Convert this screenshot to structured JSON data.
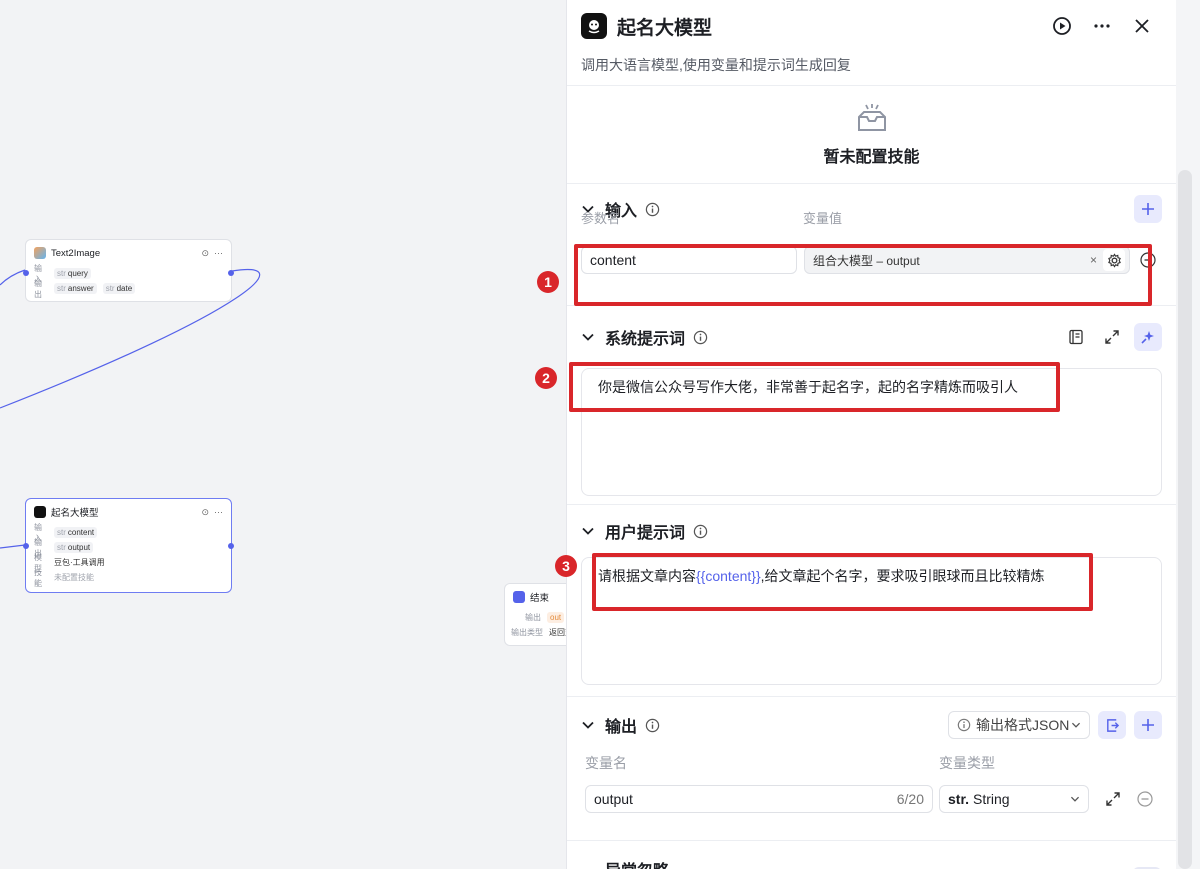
{
  "canvas": {
    "text2image": {
      "title": "Text2Image",
      "in_label": "输入",
      "out_label": "输出",
      "in_vars": [
        "query"
      ],
      "out_vars": [
        "answer",
        "date"
      ],
      "type_prefix": "str"
    },
    "naming_node": {
      "title": "起名大模型",
      "rows": [
        {
          "k": "输入",
          "v": "content"
        },
        {
          "k": "输出",
          "v": "output"
        },
        {
          "k": "模型",
          "v": "豆包·工具调用"
        },
        {
          "k": "技能",
          "v": "未配置技能"
        }
      ],
      "type_prefix": "str"
    },
    "end_node": {
      "title": "结束",
      "row1_k": "输出",
      "row1_v": "out",
      "row2_k": "输出类型",
      "row2_v": "返回变"
    }
  },
  "panel": {
    "title": "起名大模型",
    "description": "调用大语言模型,使用变量和提示词生成回复",
    "skill_empty": "暂未配置技能",
    "input": {
      "title": "输入",
      "col_param": "参数名",
      "col_value": "变量值",
      "param_value": "content",
      "var_value": "组合大模型 – output"
    },
    "system_prompt": {
      "title": "系统提示词",
      "text": "你是微信公众号写作大佬，非常善于起名字，起的名字精炼而吸引人"
    },
    "user_prompt": {
      "title": "用户提示词",
      "text_before": "请根据文章内容",
      "variable": "{{content}}",
      "text_after": ",给文章起个名字，要求吸引眼球而且比较精炼"
    },
    "output": {
      "title": "输出",
      "format_label": "输出格式JSON",
      "col_name": "变量名",
      "col_type": "变量类型",
      "var_name": "output",
      "char_count": "6/20",
      "type_prefix": "str.",
      "type_value": "String"
    },
    "next_section_title": "异常忽略"
  },
  "annotations": [
    "1",
    "2",
    "3"
  ],
  "colors": {
    "accent": "#5562ea",
    "highlight": "#d9262a"
  }
}
